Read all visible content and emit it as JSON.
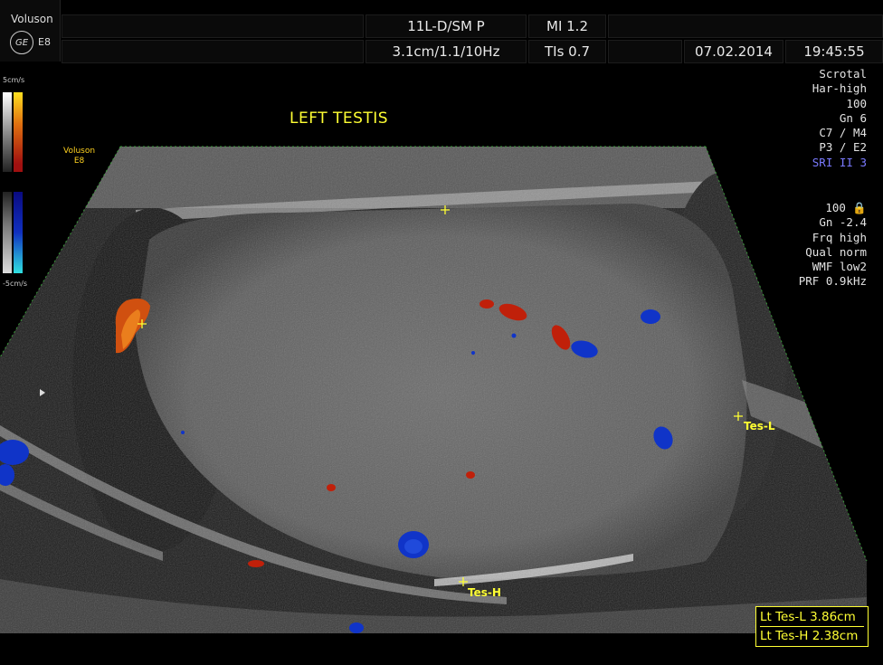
{
  "logo": {
    "brand": "Voluson",
    "maker": "GE",
    "model": "E8"
  },
  "header": {
    "probe": "11L-D/SM P",
    "mi": "MI  1.2",
    "depth_freq": "3.1cm/1.1/10Hz",
    "tis": "TIs  0.7",
    "date": "07.02.2014",
    "time": "19:45:55"
  },
  "color_scale": {
    "top_label": "5cm/s",
    "bottom_label": "-5cm/s"
  },
  "mini_logo": {
    "brand": "Voluson",
    "model": "E8"
  },
  "image_title": "LEFT  TESTIS",
  "params_top": [
    "Scrotal",
    "Har-high",
    "100",
    "Gn   6",
    "C7 / M4",
    "P3 / E2"
  ],
  "params_top_blue": "SRI II 3",
  "params_bottom": [
    "100 🔒",
    "Gn -2.4",
    "Frq high",
    "Qual norm",
    "WMF low2",
    "PRF  0.9kHz"
  ],
  "markers": {
    "tes_l": "Tes-L",
    "tes_h": "Tes-H"
  },
  "measurements": [
    {
      "label": "Lt Tes-L",
      "value": "3.86cm"
    },
    {
      "label": "Lt Tes-H",
      "value": "2.38cm"
    }
  ],
  "colors": {
    "accent_yellow": "#ffff33",
    "doppler_red": "#c0200a",
    "doppler_blue": "#1034c8",
    "sri_blue": "#7a7aff"
  }
}
